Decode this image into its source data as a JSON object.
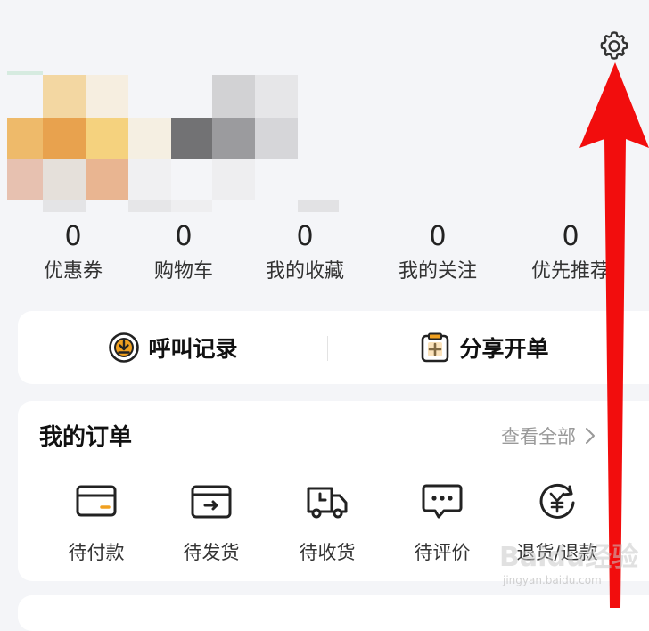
{
  "header": {
    "settings_icon": "gear-icon"
  },
  "stats": [
    {
      "value": "0",
      "label": "优惠券"
    },
    {
      "value": "0",
      "label": "购物车"
    },
    {
      "value": "0",
      "label": "我的收藏"
    },
    {
      "value": "0",
      "label": "我的关注"
    },
    {
      "value": "0",
      "label": "优先推荐"
    }
  ],
  "quick_actions": [
    {
      "label": "呼叫记录",
      "icon": "call-record-icon"
    },
    {
      "label": "分享开单",
      "icon": "share-order-icon"
    }
  ],
  "orders": {
    "title": "我的订单",
    "view_all": "查看全部",
    "items": [
      {
        "label": "待付款",
        "icon": "card-icon"
      },
      {
        "label": "待发货",
        "icon": "box-send-icon"
      },
      {
        "label": "待收货",
        "icon": "truck-icon"
      },
      {
        "label": "待评价",
        "icon": "chat-bubble-icon"
      },
      {
        "label": "退货/退款",
        "icon": "refund-yen-icon"
      }
    ]
  },
  "watermark": {
    "text": "Baidu经验",
    "url": "jingyan.baidu.com"
  },
  "colors": {
    "background": "#f4f5f8",
    "arrow": "#f20d0d",
    "accent": "#f0a020"
  }
}
